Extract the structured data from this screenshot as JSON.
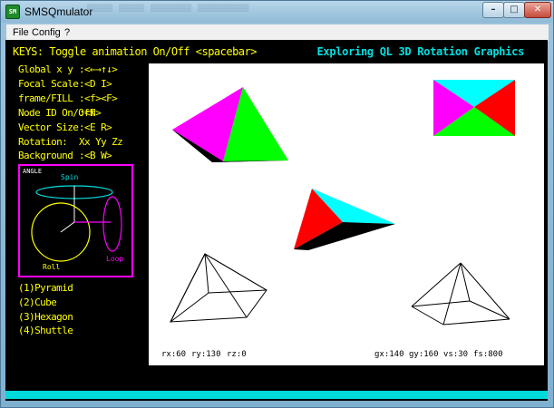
{
  "window": {
    "title": "SMSQmulator",
    "icon": "smsq-app-icon",
    "controls": {
      "minimize": "–",
      "maximize": "□",
      "close": "✕"
    }
  },
  "menu": [
    "File",
    "Config",
    "?"
  ],
  "header": {
    "left": "KEYS: Toggle animation On/Off <spacebar>",
    "right": "Exploring QL 3D Rotation Graphics",
    "colors": {
      "left": "#ffff00",
      "right": "#00e0e0"
    }
  },
  "keys": [
    {
      "label": "Global x y",
      "value": ":<←→↑↓>"
    },
    {
      "label": "Focal Scale",
      "value": ":<D  I>"
    },
    {
      "label": "frame/FILL",
      "value": ":<f><F>"
    },
    {
      "label": "Node ID On/Off",
      "value": ":<N>"
    },
    {
      "label": "Vector Size",
      "value": ":<E  R>"
    },
    {
      "label": "Rotation:",
      "value": "Xx Yy Zz"
    },
    {
      "label": "Background",
      "value": ":<B  W>"
    }
  ],
  "angle": {
    "title": "ANGLE",
    "spin": "Spin",
    "roll": "Roll",
    "loop": "Loop",
    "colors": {
      "frame": "#ff00ff",
      "spin": "#00e0e0",
      "roll": "#ffff00",
      "loop": "#ff00ff"
    }
  },
  "shapes": [
    "(1)Pyramid",
    "(2)Cube",
    "(3)Hexagon",
    "(4)Shuttle"
  ],
  "status": {
    "rx": "rx:60",
    "ry": "ry:130",
    "rz": "rz:0",
    "gx": "gx:140",
    "gy": "gy:160",
    "vs": "vs:30",
    "fs": "fs:800"
  },
  "face_colors": {
    "magenta": "#ff00ff",
    "green": "#00ff00",
    "red": "#ff0000",
    "cyan": "#00ffff",
    "black": "#000000"
  }
}
